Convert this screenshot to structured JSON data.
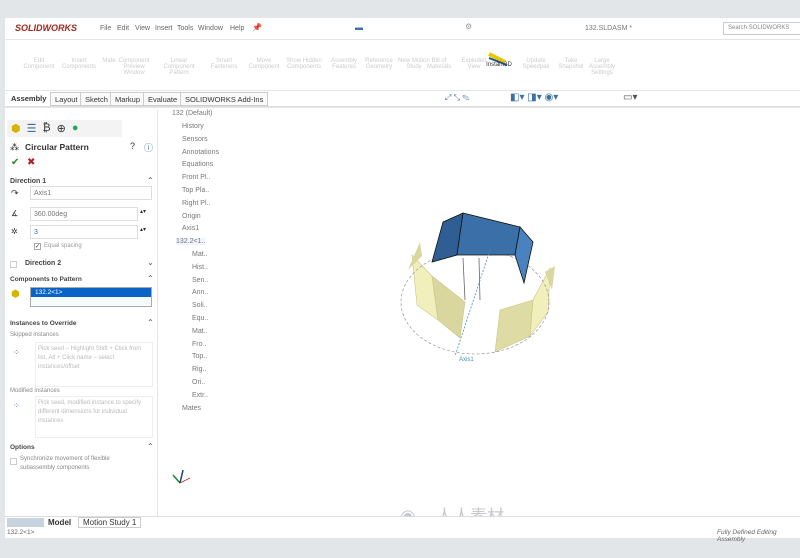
{
  "app": {
    "logo": "SOLIDWORKS",
    "menu": [
      "File",
      "Edit",
      "View",
      "Insert",
      "Tools",
      "Window",
      "Help"
    ],
    "document_title": "132.SLDASM *",
    "search_placeholder": "Search SOLIDWORKS"
  },
  "ribbon": {
    "items": [
      "Edit Component",
      "Insert Components",
      "Mate",
      "Component Preview Window",
      "Linear Component Pattern",
      "Smart Fasteners",
      "Move Component",
      "Show Hidden Components",
      "Assembly Features",
      "Reference Geometry",
      "New Motion Study",
      "Bill of Materials",
      "Exploded View",
      "Instant3D",
      "Update Speedpak",
      "Take Snapshot",
      "Large Assembly Settings"
    ],
    "active_item": "Instant3D"
  },
  "tabs": [
    "Assembly",
    "Layout",
    "Sketch",
    "Markup",
    "Evaluate",
    "SOLIDWORKS Add-Ins"
  ],
  "panel": {
    "title": "Circular Pattern",
    "direction1": {
      "label": "Direction 1",
      "axis": "Axis1",
      "angle": "360.00deg",
      "count": "3",
      "equal_spacing": "Equal spacing"
    },
    "direction2": {
      "label": "Direction 2"
    },
    "components": {
      "label": "Components to Pattern",
      "selected": "132.2<1>"
    },
    "override": {
      "label": "Instances to Override",
      "skipped_label": "Skipped instances",
      "skipped_hint": "Pick seed – Highlight Shift + Click from list, Alt + Click name – select instances/offset",
      "modified_label": "Modified instances",
      "modified_hint": "Pick seed, modified instance to specify different dimensions for individual instances"
    },
    "options": {
      "label": "Options",
      "sync": "Synchronize movement of flexible subassembly components"
    }
  },
  "tree": {
    "root": "132 (Default)",
    "items": [
      "History",
      "Sensors",
      "Annotations",
      "Equations",
      "Front Pl..",
      "Top Pla..",
      "Right Pl..",
      "Origin",
      "Axis1",
      "132.2<1..",
      "Mat..",
      "Hist..",
      "Sen..",
      "Ann..",
      "Soli..",
      "Equ..",
      "Mat..",
      "Fro..",
      "Top..",
      "Rig..",
      "Ori..",
      "Extr..",
      "Mates"
    ]
  },
  "viewport": {
    "axis_label": "Axis1",
    "colors": {
      "selected": "#3a6fa8",
      "preview": "#e8e6b0"
    }
  },
  "bottom_tabs": [
    "Model",
    "Motion Study 1"
  ],
  "status": {
    "left": "132.2<1>",
    "right": "Fully Defined   Editing Assembly"
  },
  "watermark": "人人素材"
}
